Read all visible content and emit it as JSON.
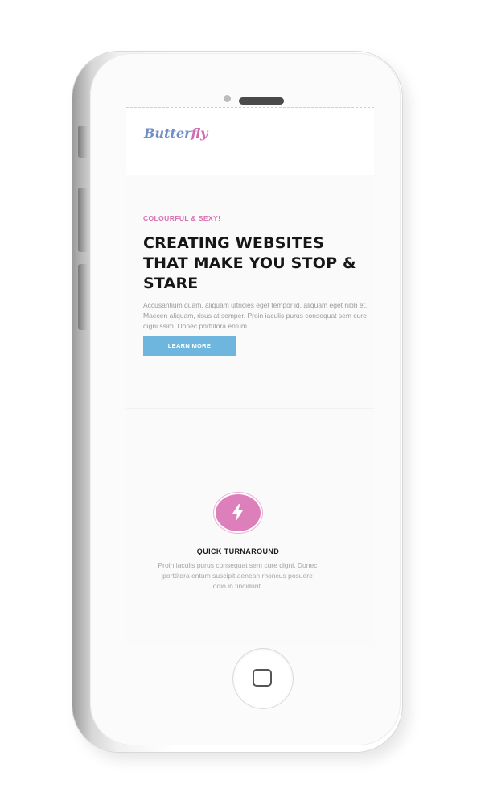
{
  "brand": {
    "logo_main": "Butter",
    "logo_tail": "fly",
    "logo_color": "#6f8fc6",
    "logo_accent": "#d16ab0"
  },
  "hero": {
    "eyebrow": "COLOURFUL & SEXY!",
    "headline": "CREATING WEBSITES THAT MAKE YOU STOP & STARE",
    "body": "Accusantium quam, aliquam ultricies eget tempor id, aliquam eget nibh et. Maecen aliquam, risus at semper. Proin iaculis purus consequat sem cure digni ssim. Donec porttitora entum.",
    "cta_label": "LEARN MORE",
    "cta_color": "#6fb6df"
  },
  "feature": {
    "icon": "lightning-icon",
    "icon_color": "#dc7fbb",
    "title": "QUICK TURNAROUND",
    "text": "Proin iaculis purus consequat sem cure digni. Donec porttitora entum suscipit aenean rhoncus posuere odio in tincidunt."
  },
  "device": {
    "type": "phone",
    "icons": [
      "speaker-icon",
      "camera-icon",
      "home-button-icon"
    ]
  }
}
